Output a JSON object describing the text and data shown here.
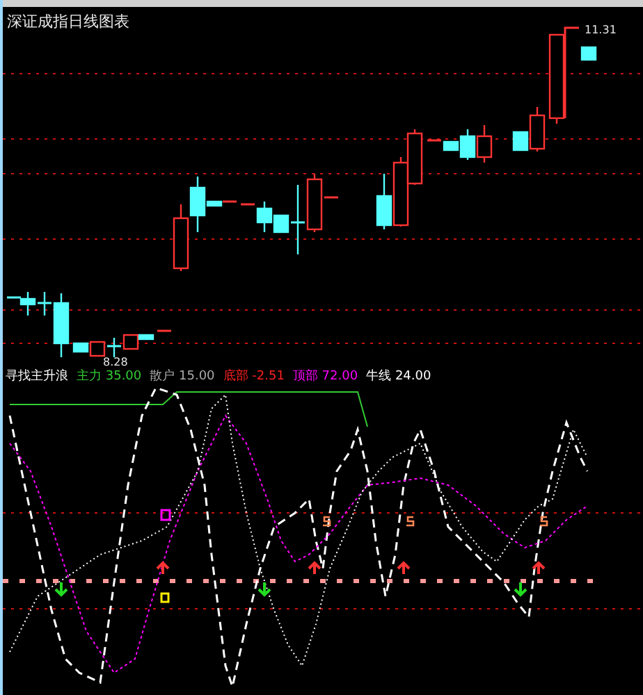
{
  "price_chart": {
    "title": "深证成指日线图表",
    "high_label": "11.31",
    "low_label": "8.28"
  },
  "indicator": {
    "legend": [
      {
        "text": "寻找主升浪",
        "color": "#ffffff"
      },
      {
        "text": "主力 35.00",
        "color": "#33cc33"
      },
      {
        "text": "散户 15.00",
        "color": "#aaaaaa"
      },
      {
        "text": "底部 -2.51",
        "color": "#ff2020"
      },
      {
        "text": "顶部 72.00",
        "color": "#ff00ff"
      },
      {
        "text": "牛线 24.00",
        "color": "#ffffff"
      }
    ]
  }
}
